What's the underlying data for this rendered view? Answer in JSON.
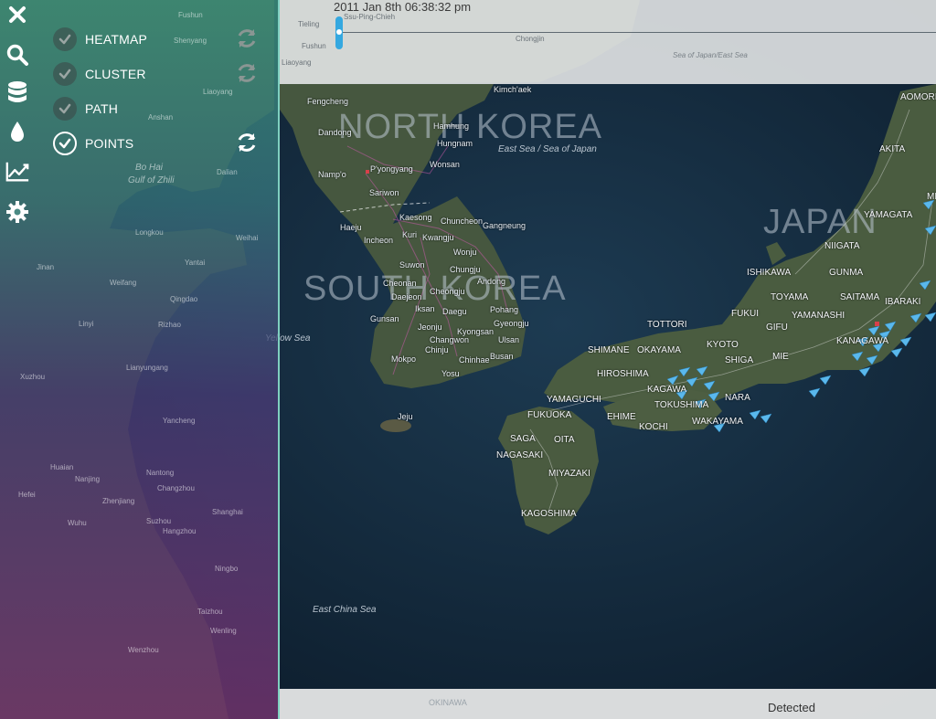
{
  "timeline": {
    "label": "2011 Jan 8th 06:38:32 pm",
    "handle_label": "timeline-handle"
  },
  "sidebar": {
    "icons": [
      "close-icon",
      "search-icon",
      "database-icon",
      "drop-icon",
      "line-chart-icon",
      "gear-icon"
    ],
    "layers": [
      {
        "label": "HEATMAP",
        "checked": true,
        "has_refresh": true
      },
      {
        "label": "CLUSTER",
        "checked": true,
        "has_refresh": true
      },
      {
        "label": "PATH",
        "checked": true,
        "has_refresh": false
      },
      {
        "label": "POINTS",
        "checked": true,
        "has_refresh": true
      }
    ]
  },
  "map": {
    "countries": {
      "north_korea": "NORTH KOREA",
      "south_korea": "SOUTH KOREA",
      "japan": "JAPAN"
    },
    "seas": {
      "east_sea": "East Sea / Sea of Japan",
      "sea_of_japan_top": "Sea of Japan/East Sea",
      "yellow_sea": "Yellow Sea",
      "east_china_sea": "East China Sea",
      "bohai": "Bo Hai",
      "bohai_gulf": "Gulf of Zhili"
    },
    "korea_cities": [
      "Kimch'aek",
      "Fengcheng",
      "Hamhung",
      "Hungnam",
      "Dandong",
      "Wonsan",
      "Namp'o",
      "P'yongyang",
      "Sariwon",
      "Kaesong",
      "Chuncheon",
      "Gangneung",
      "Haeju",
      "Incheon",
      "Kuri",
      "Kwangju",
      "Wonju",
      "Suwon",
      "Chungju",
      "Andong",
      "Cheonan",
      "Cheongju",
      "Daejeon",
      "Daegu",
      "Pohang",
      "Iksan",
      "Gyeongju",
      "Gunsan",
      "Jeonju",
      "Kyongsan",
      "Changwon",
      "Ulsan",
      "Chinju",
      "Busan",
      "Chinhae",
      "Mokpo",
      "Yosu",
      "Jeju"
    ],
    "japan_prefectures": [
      "AOMORI",
      "AKITA",
      "MIYAGI",
      "YAMAGATA",
      "NIIGATA",
      "ISHIKAWA",
      "GUNMA",
      "TOYAMA",
      "SAITAMA",
      "IBARAKI",
      "FUKUI",
      "GIFU",
      "YAMANASHI",
      "TOTTORI",
      "KANAGAWA",
      "KYOTO",
      "SHIMANE",
      "OKAYAMA",
      "SHIGA",
      "MIE",
      "HIROSHIMA",
      "KAGAWA",
      "NARA",
      "YAMAGUCHI",
      "TOKUSHIMA",
      "FUKUOKA",
      "EHIME",
      "WAKAYAMA",
      "KOCHI",
      "SAGA",
      "OITA",
      "NAGASAKI",
      "MIYAZAKI",
      "KAGOSHIMA"
    ],
    "china_cities": [
      "Tieling",
      "Fushun",
      "Shenyang",
      "Liaoyang",
      "Anshan",
      "Dalian",
      "Longkou",
      "Weihai",
      "Yantai",
      "Weifang",
      "Qingdao",
      "Rizhao",
      "Lianyungang",
      "Yancheng",
      "Nantong",
      "Changzhou",
      "Shanghai",
      "Suzhou",
      "Hangzhou",
      "Ningbo",
      "Wenzhou",
      "Taizhou",
      "Wenling",
      "Jinan",
      "Linyi",
      "Xuzhou",
      "Huaian",
      "Nanjing",
      "Hefei",
      "Wuhu",
      "Zhenjiang"
    ],
    "top_strip_cities": [
      "Ssu-Ping-Chieh",
      "Tieling",
      "Fushun",
      "Liaoyang",
      "Chongjin"
    ]
  },
  "status": {
    "text": "Detected",
    "okinawa": "OKINAWA"
  },
  "colors": {
    "accent": "#34a8e0",
    "point_marker": "#5ab8ec",
    "land": "#3a4a3a",
    "sea": "#152a3e"
  }
}
